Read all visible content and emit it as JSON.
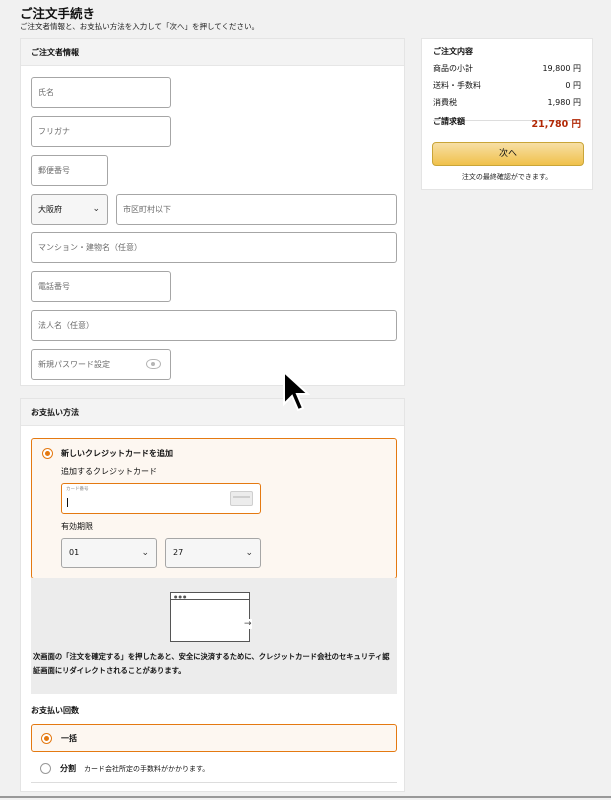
{
  "page": {
    "title": "ご注文手続き",
    "description": "ご注文者情報と、お支払い方法を入力して「次へ」を押してください。"
  },
  "orderer": {
    "heading": "ご注文者情報",
    "name_placeholder": "氏名",
    "furigana_placeholder": "フリガナ",
    "postal_placeholder": "郵便番号",
    "prefecture_value": "大阪府",
    "city_placeholder": "市区町村以下",
    "building_placeholder": "マンション・建物名（任意）",
    "phone_placeholder": "電話番号",
    "company_placeholder": "法人名（任意）",
    "password_placeholder": "新規パスワード設定"
  },
  "payment": {
    "heading": "お支払い方法",
    "new_card_label": "新しいクレジットカードを追加",
    "add_card_label": "追加するクレジットカード",
    "card_number_label": "カード番号",
    "expiry_label": "有効期限",
    "expiry_month": "01",
    "expiry_year": "27",
    "redirect_note": "次画面の「注文を確定する」を押したあと、安全に決済するために、クレジットカード会社のセキュリティ認証画面にリダイレクトされることがあります。",
    "installments_heading": "お支払い回数",
    "lump_sum_label": "一括",
    "split_label": "分割",
    "split_note": "カード会社所定の手数料がかかります。"
  },
  "summary": {
    "heading": "ご注文内容",
    "subtotal_label": "商品の小計",
    "subtotal_value": "19,800 円",
    "shipping_label": "送料・手数料",
    "shipping_value": "0 円",
    "tax_label": "消費税",
    "tax_value": "1,980 円",
    "total_label": "ご請求額",
    "total_value": "21,780 円",
    "next_button": "次へ",
    "note": "注文の最終確認ができます。"
  },
  "colors": {
    "accent_orange": "#e47911",
    "total_red": "#b12704",
    "button_yellow": "#f0c14b"
  }
}
